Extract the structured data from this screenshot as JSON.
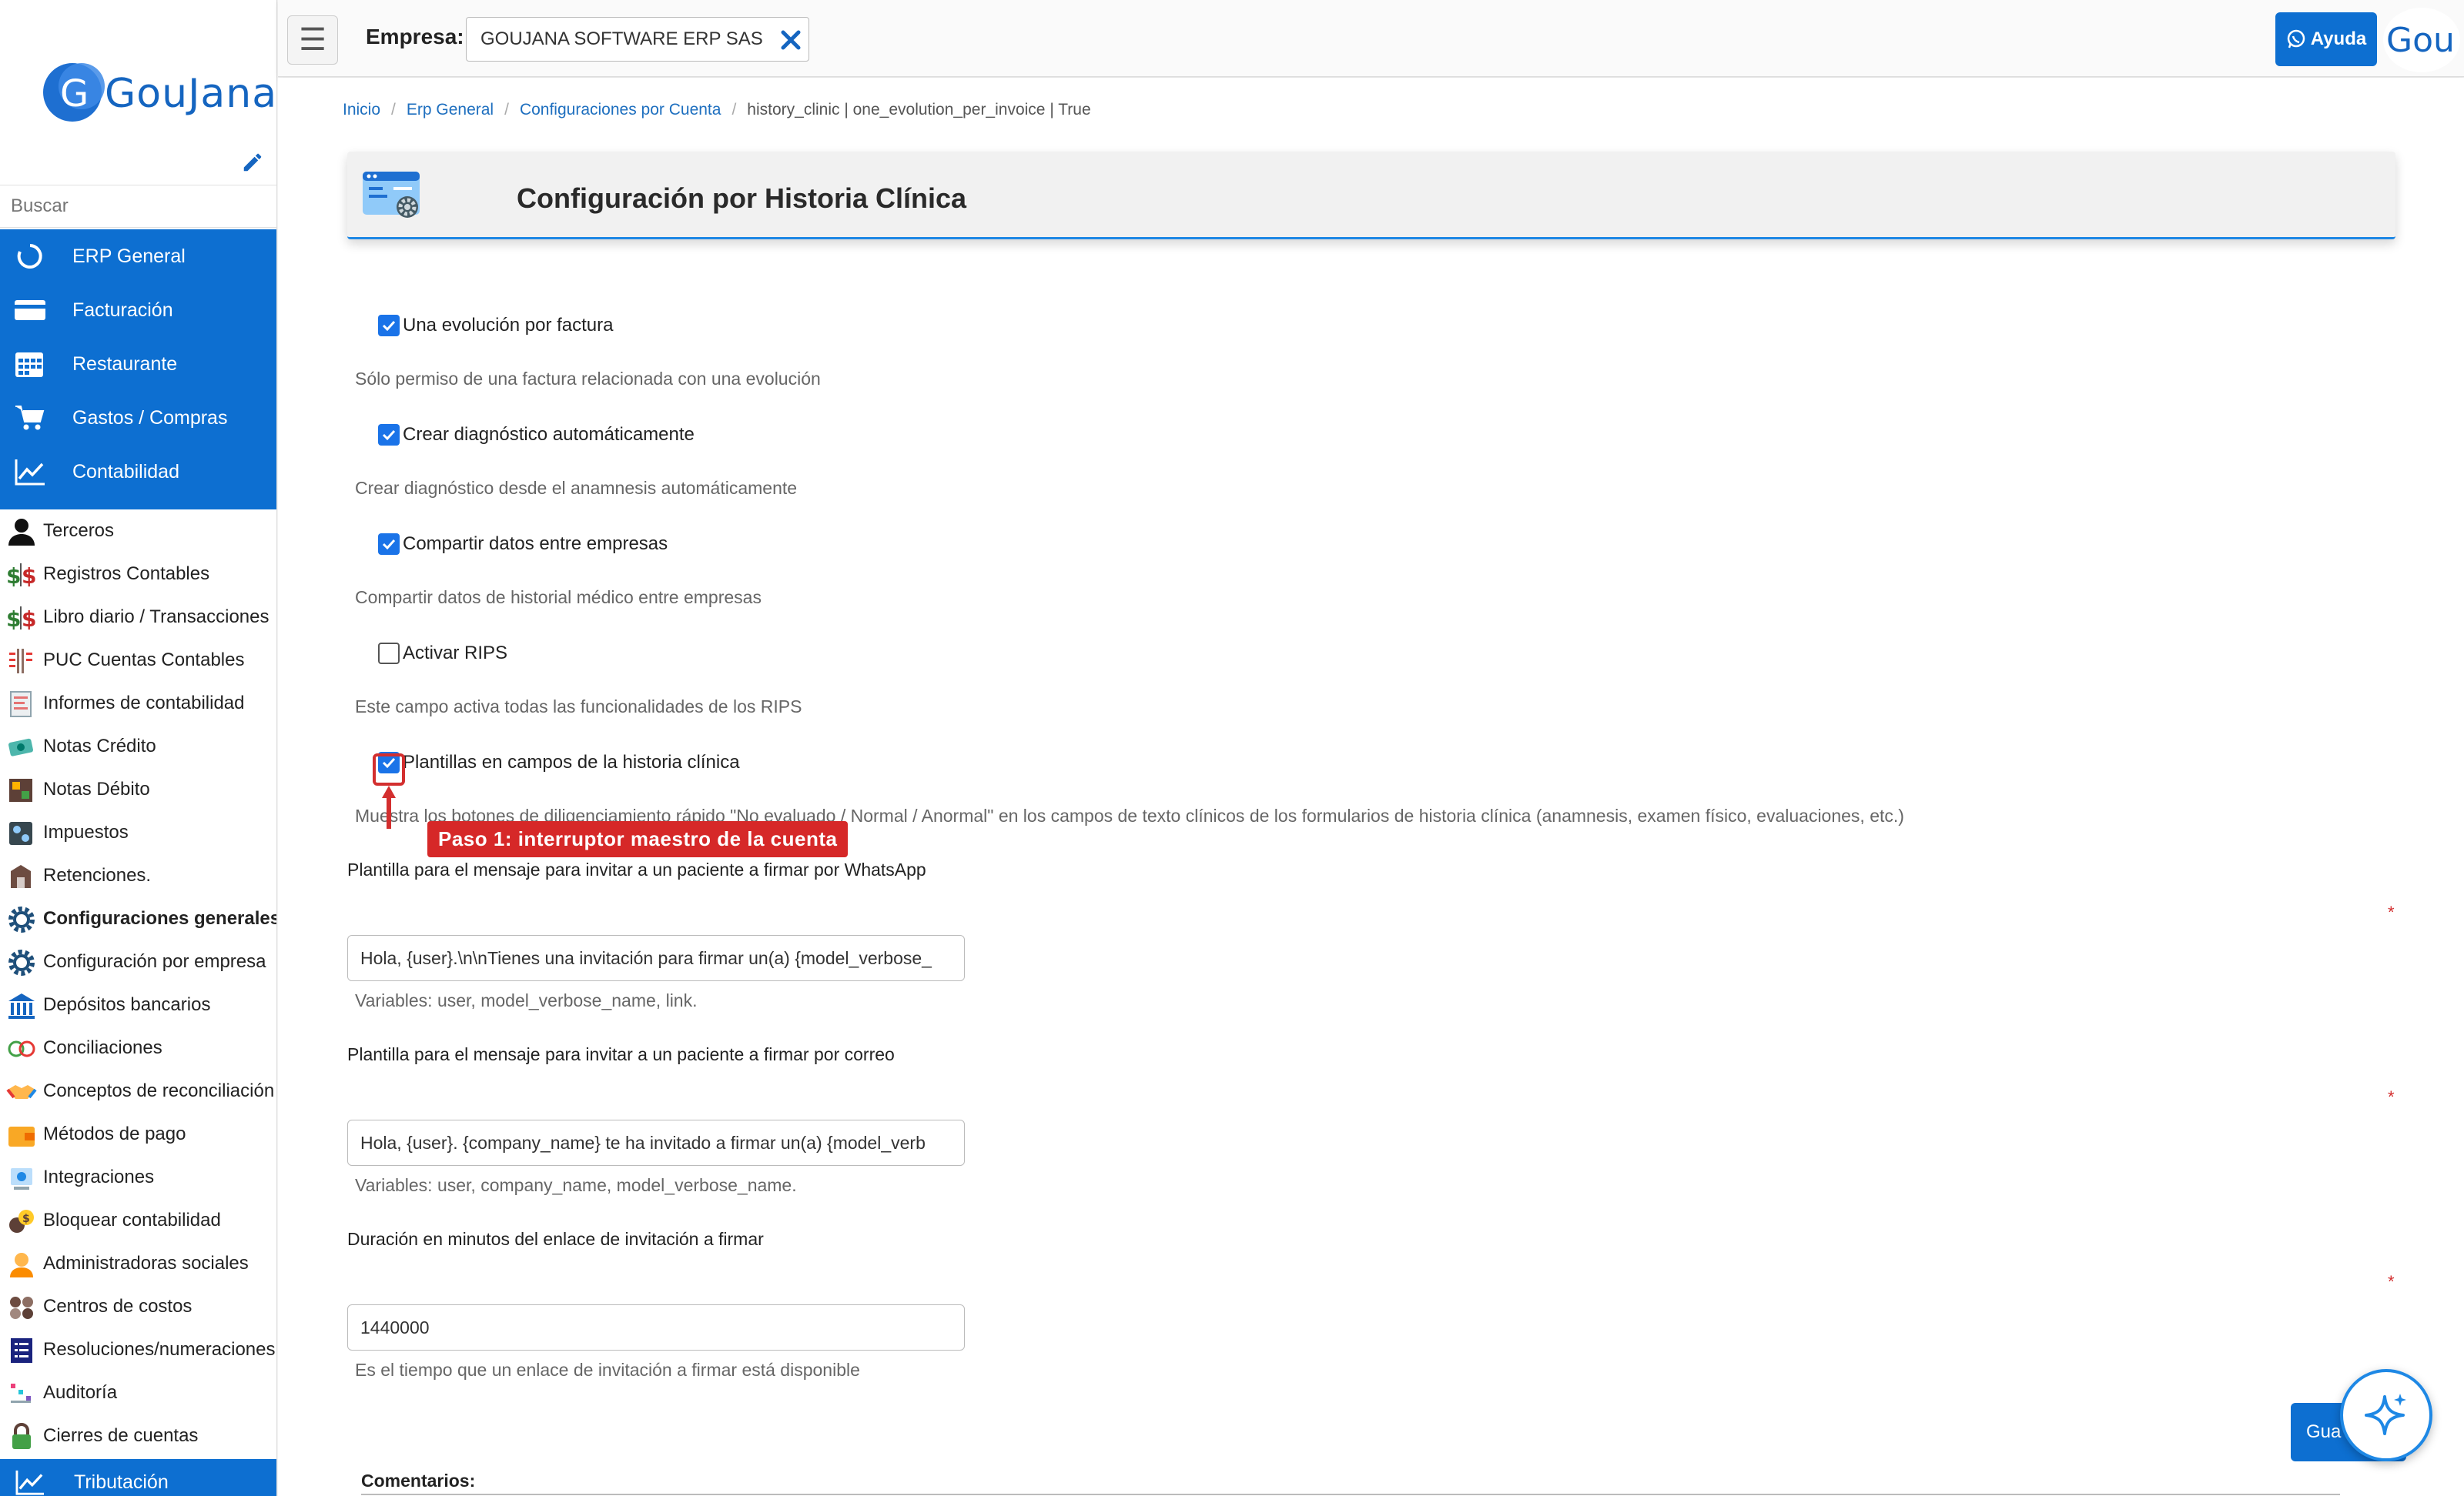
{
  "brand": {
    "name": "GouJana",
    "logo_letter": "G",
    "accent": "#0d6fd1"
  },
  "sidebar": {
    "search_placeholder": "Buscar",
    "main_modules": [
      {
        "label": "ERP General",
        "icon": "circle-loader-icon"
      },
      {
        "label": "Facturación",
        "icon": "credit-card-icon"
      },
      {
        "label": "Restaurante",
        "icon": "calendar-icon"
      },
      {
        "label": "Gastos / Compras",
        "icon": "cart-icon"
      },
      {
        "label": "Contabilidad",
        "icon": "chart-line-icon"
      }
    ],
    "items": [
      {
        "label": "Terceros",
        "icon": "person-icon"
      },
      {
        "label": "Registros Contables",
        "icon": "dollar-icon"
      },
      {
        "label": "Libro diario / Transacciones",
        "icon": "dollar-icon"
      },
      {
        "label": "PUC Cuentas Contables",
        "icon": "ledger-icon"
      },
      {
        "label": "Informes de contabilidad",
        "icon": "report-icon"
      },
      {
        "label": "Notas Crédito",
        "icon": "money-icon"
      },
      {
        "label": "Notas Débito",
        "icon": "money-stack-icon"
      },
      {
        "label": "Impuestos",
        "icon": "tax-icon"
      },
      {
        "label": "Retenciones.",
        "icon": "retention-icon"
      },
      {
        "label": "Configuraciones generales",
        "icon": "gear-icon",
        "active": true
      },
      {
        "label": "Configuración por empresa",
        "icon": "gear-icon"
      },
      {
        "label": "Depósitos bancarios",
        "icon": "bank-icon"
      },
      {
        "label": "Conciliaciones",
        "icon": "reconcile-icon"
      },
      {
        "label": "Conceptos de reconciliación",
        "icon": "handshake-icon"
      },
      {
        "label": "Métodos de pago",
        "icon": "wallet-icon"
      },
      {
        "label": "Integraciones",
        "icon": "integration-icon"
      },
      {
        "label": "Bloquear contabilidad",
        "icon": "lock-money-icon"
      },
      {
        "label": "Administradoras sociales",
        "icon": "people-icon"
      },
      {
        "label": "Centros de costos",
        "icon": "cost-center-icon"
      },
      {
        "label": "Resoluciones/numeraciones",
        "icon": "list-icon"
      },
      {
        "label": "Auditoría",
        "icon": "audit-icon"
      },
      {
        "label": "Cierres de cuentas",
        "icon": "padlock-icon"
      }
    ],
    "bottom_module": {
      "label": "Tributación",
      "icon": "chart-line-icon"
    }
  },
  "topbar": {
    "empresa_label": "Empresa:",
    "empresa_value": "GOUJANA SOFTWARE ERP SAS",
    "help_label": "Ayuda",
    "avatar_text": "Gou"
  },
  "breadcrumb": {
    "items": [
      "Inicio",
      "Erp General",
      "Configuraciones por Cuenta"
    ],
    "current": "history_clinic | one_evolution_per_invoice | True"
  },
  "page": {
    "title": "Configuración por Historia Clínica"
  },
  "settings": [
    {
      "label": "Una evolución por factura",
      "help": "Sólo permiso de una factura relacionada con una evolución",
      "checked": true
    },
    {
      "label": "Crear diagnóstico automáticamente",
      "help": "Crear diagnóstico desde el anamnesis automáticamente",
      "checked": true
    },
    {
      "label": "Compartir datos entre empresas",
      "help": "Compartir datos de historial médico entre empresas",
      "checked": true
    },
    {
      "label": "Activar RIPS",
      "help": "Este campo activa todas las funcionalidades de los RIPS",
      "checked": false
    },
    {
      "label": "Plantillas en campos de la historia clínica",
      "help": "Muestra los botones de diligenciamiento rápido \"No evaluado / Normal / Anormal\" en los campos de texto clínicos de los formularios de historia clínica (anamnesis, examen físico, evaluaciones, etc.)",
      "checked": true
    }
  ],
  "annotation": {
    "text": "Paso 1: interruptor maestro de la cuenta",
    "color": "#d62828"
  },
  "fields": {
    "whatsapp": {
      "label": "Plantilla para el mensaje para invitar a un paciente a firmar por WhatsApp",
      "value": "Hola, {user}.\\n\\nTienes una invitación para firmar un(a) {model_verbose_",
      "help": "Variables: user, model_verbose_name, link."
    },
    "email": {
      "label": "Plantilla para el mensaje para invitar a un paciente a firmar por correo",
      "value": "Hola, {user}. {company_name} te ha invitado a firmar un(a) {model_verb",
      "help": "Variables: user, company_name, model_verbose_name."
    },
    "duration": {
      "label": "Duración en minutos del enlace de invitación a firmar",
      "value": "1440000",
      "help": "Es el tiempo que un enlace de invitación a firmar está disponible"
    },
    "required_mark": "*"
  },
  "actions": {
    "save_label": "Gua"
  },
  "comments": {
    "label": "Comentarios:"
  }
}
